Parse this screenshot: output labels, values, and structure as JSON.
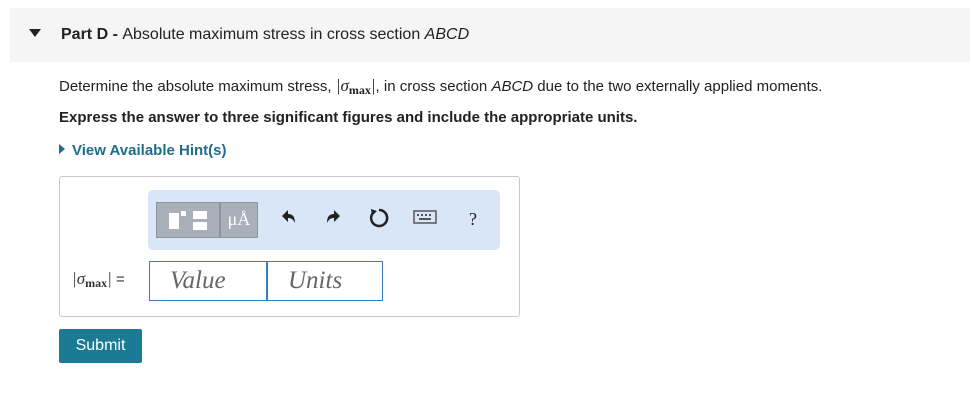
{
  "part": {
    "label": "Part D",
    "separator": " - ",
    "title_prefix": "Absolute maximum stress in cross section ",
    "title_section": "ABCD"
  },
  "question": {
    "prefix": "Determine the absolute maximum stress, ",
    "symbol": "σ",
    "subscript": "max",
    "middle": ", in cross section ",
    "section": "ABCD",
    "suffix": " due to the two externally applied moments."
  },
  "instruction": "Express the answer to three significant figures and include the appropriate units.",
  "hint_link": "View Available Hint(s)",
  "toolbar": {
    "units_button": "μÅ",
    "undo_icon": "undo-icon",
    "redo_icon": "redo-icon",
    "reset_icon": "reset-icon",
    "keyboard_icon": "keyboard-icon",
    "help": "?"
  },
  "answer": {
    "label_symbol": "σ",
    "label_subscript": "max",
    "equals": "=",
    "value_placeholder": "Value",
    "units_placeholder": "Units"
  },
  "submit_label": "Submit"
}
